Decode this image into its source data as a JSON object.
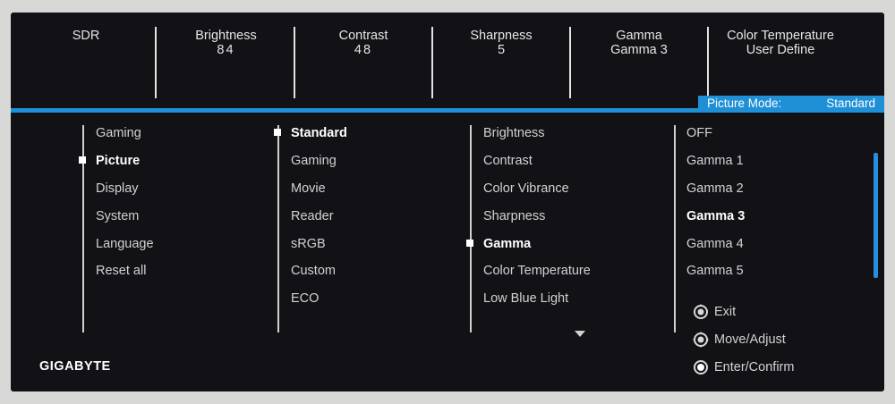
{
  "status_bar": [
    {
      "label": "SDR",
      "value": ""
    },
    {
      "label": "Brightness",
      "value": "84"
    },
    {
      "label": "Contrast",
      "value": "48"
    },
    {
      "label": "Sharpness",
      "value": "5"
    },
    {
      "label": "Gamma",
      "value": "Gamma 3"
    },
    {
      "label": "Color Temperature",
      "value": "User Define"
    }
  ],
  "picture_mode": {
    "label": "Picture Mode:",
    "value": "Standard"
  },
  "main_menu": [
    "Gaming",
    "Picture",
    "Display",
    "System",
    "Language",
    "Reset all"
  ],
  "picture_modes": [
    "Standard",
    "Gaming",
    "Movie",
    "Reader",
    "sRGB",
    "Custom",
    "ECO"
  ],
  "picture_settings": [
    "Brightness",
    "Contrast",
    "Color Vibrance",
    "Sharpness",
    "Gamma",
    "Color Temperature",
    "Low Blue Light"
  ],
  "gamma_options": [
    "OFF",
    "Gamma 1",
    "Gamma 2",
    "Gamma 3",
    "Gamma 4",
    "Gamma 5"
  ],
  "hints": [
    "Exit",
    "Move/Adjust",
    "Enter/Confirm"
  ],
  "brand": "GIGABYTE",
  "colors": {
    "accent": "#1f8fd6",
    "background": "#121116",
    "text": "#d2d2d2"
  },
  "icons": {
    "hint_icon": "joystick-button-icon",
    "more_icon": "triangle-down-icon"
  }
}
